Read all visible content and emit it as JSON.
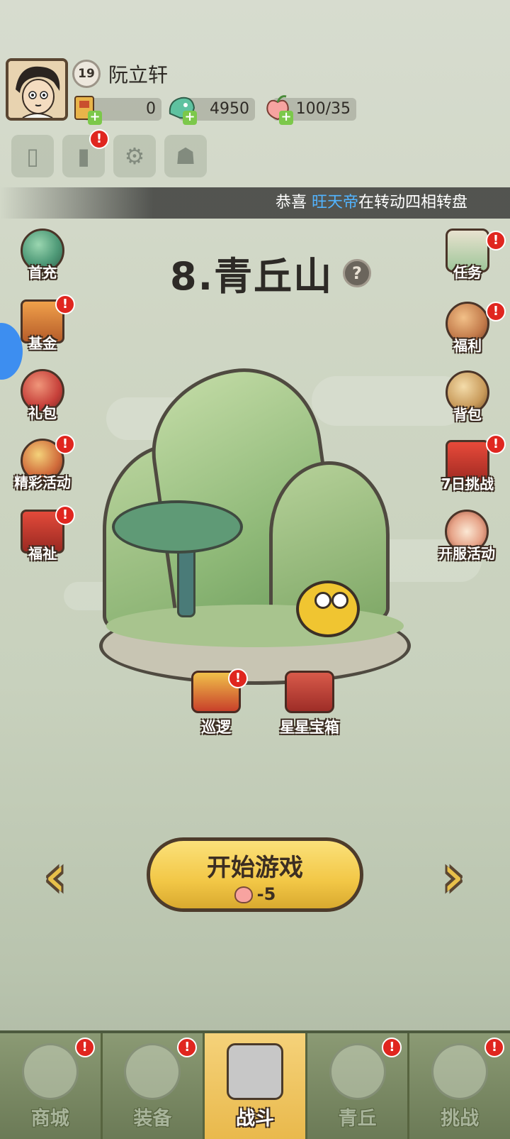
{
  "player": {
    "level": "19",
    "name": "阮立轩"
  },
  "resources": [
    {
      "name": "scroll",
      "value": "0"
    },
    {
      "name": "jade",
      "value": "4950"
    },
    {
      "name": "peach",
      "value": "100/35"
    }
  ],
  "marquee": {
    "prefix": "恭喜",
    "highlight": "旺天帝",
    "suffix": "在转动四相转盘"
  },
  "stage": {
    "title": "8.青丘山",
    "help": "?"
  },
  "left_buttons": [
    {
      "label": "首充",
      "alert": false
    },
    {
      "label": "基金",
      "alert": true
    },
    {
      "label": "礼包",
      "alert": false
    },
    {
      "label": "精彩活动",
      "alert": true
    },
    {
      "label": "福祉",
      "alert": true
    }
  ],
  "right_buttons": [
    {
      "label": "任务",
      "alert": true
    },
    {
      "label": "福利",
      "alert": true
    },
    {
      "label": "背包",
      "alert": false
    },
    {
      "label": "7日挑战",
      "alert": true
    },
    {
      "label": "开服活动",
      "alert": false
    }
  ],
  "stage_buttons": [
    {
      "label": "巡逻",
      "alert": true
    },
    {
      "label": "星星宝箱",
      "alert": false
    }
  ],
  "start": {
    "label": "开始游戏",
    "cost": "-5"
  },
  "nav": [
    {
      "label": "商城",
      "alert": true,
      "active": false
    },
    {
      "label": "装备",
      "alert": true,
      "active": false
    },
    {
      "label": "战斗",
      "alert": false,
      "active": true
    },
    {
      "label": "青丘",
      "alert": true,
      "active": false
    },
    {
      "label": "挑战",
      "alert": true,
      "active": false
    }
  ],
  "alert_symbol": "!",
  "colors": {
    "highlight": "#52b4ff",
    "alert": "#e0261f",
    "start_button": "#f2c746"
  }
}
